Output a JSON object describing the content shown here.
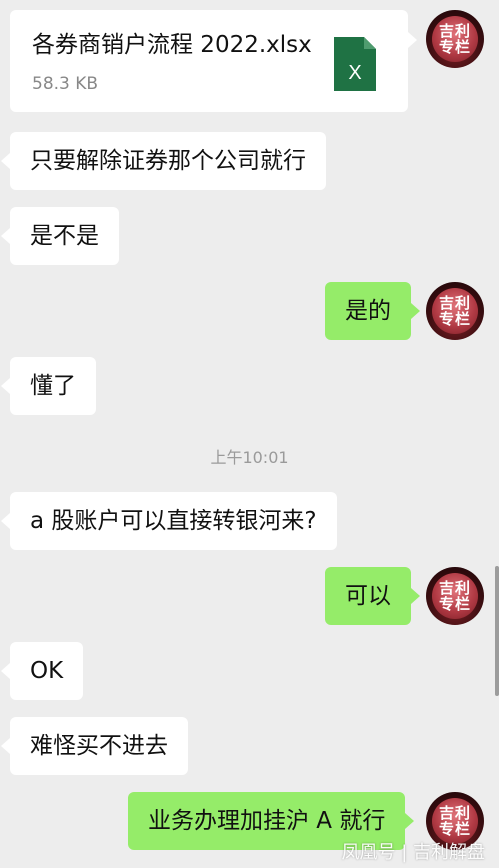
{
  "file": {
    "name": "各券商销户流程 2022.xlsx",
    "size": "58.3 KB",
    "icon": "excel-file-icon",
    "icon_letter": "X",
    "icon_color": "#1f7244"
  },
  "avatar": {
    "line1": "吉利",
    "line2": "专栏"
  },
  "messages": [
    {
      "side": "left",
      "text": "只要解除证券那个公司就行"
    },
    {
      "side": "left",
      "text": "是不是"
    },
    {
      "side": "right",
      "text": "是的"
    },
    {
      "side": "left",
      "text": "懂了"
    },
    {
      "side": "left",
      "text": "a 股账户可以直接转银河来?"
    },
    {
      "side": "right",
      "text": "可以"
    },
    {
      "side": "left",
      "text": "OK"
    },
    {
      "side": "left",
      "text": "难怪买不进去"
    },
    {
      "side": "right",
      "text": "业务办理加挂沪 A 就行"
    }
  ],
  "timestamp": "上午10:01",
  "watermark": "凤凰号 | 吉利解盘",
  "colors": {
    "background": "#ededed",
    "left_bubble": "#ffffff",
    "right_bubble": "#95ec69"
  }
}
